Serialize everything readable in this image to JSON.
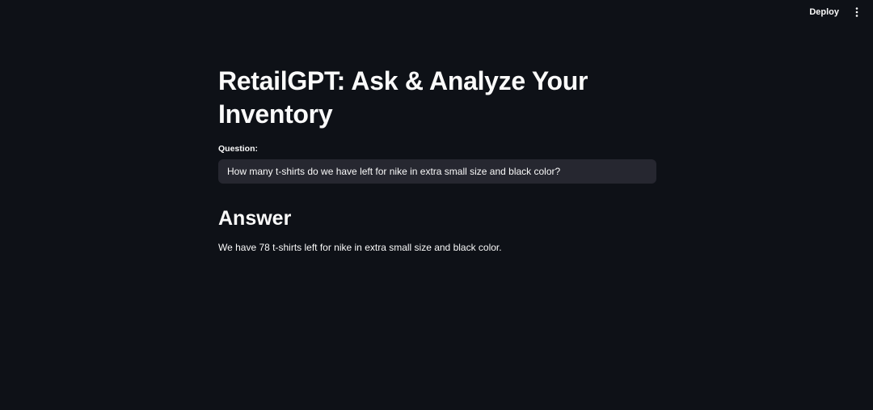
{
  "header": {
    "deploy_label": "Deploy",
    "menu_icon": "vertical-ellipsis-icon"
  },
  "main": {
    "title": "RetailGPT: Ask & Analyze Your Inventory",
    "question_label": "Question:",
    "question_value": "How many t-shirts do we have left for nike in extra small size and black color?",
    "answer_heading": "Answer",
    "answer_text": "We have 78 t-shirts left for nike in extra small size and black color."
  },
  "colors": {
    "background": "#0e1117",
    "input_background": "#262730",
    "text": "#fafafa"
  }
}
